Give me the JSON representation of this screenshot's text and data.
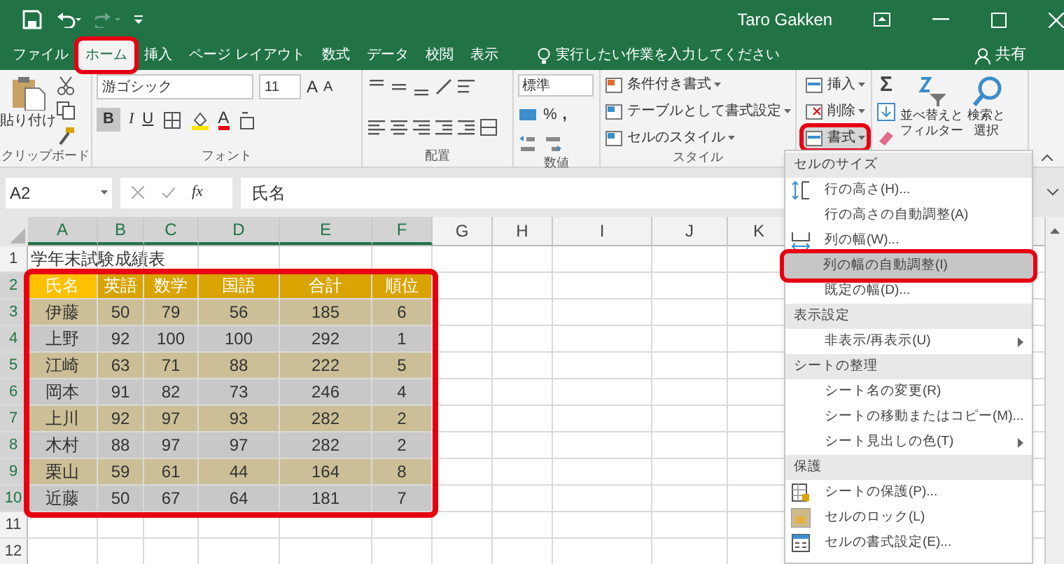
{
  "title_bar": {
    "user": "Taro Gakken"
  },
  "tabs": [
    {
      "label": "ファイル",
      "selected": false,
      "highlighted": false
    },
    {
      "label": "ホーム",
      "selected": true,
      "highlighted": true
    },
    {
      "label": "挿入",
      "selected": false,
      "highlighted": false
    },
    {
      "label": "ページ レイアウト",
      "selected": false,
      "highlighted": false
    },
    {
      "label": "数式",
      "selected": false,
      "highlighted": false
    },
    {
      "label": "データ",
      "selected": false,
      "highlighted": false
    },
    {
      "label": "校閲",
      "selected": false,
      "highlighted": false
    },
    {
      "label": "表示",
      "selected": false,
      "highlighted": false
    }
  ],
  "tell_me": {
    "placeholder": "実行したい作業を入力してください"
  },
  "share_button": "共有",
  "ribbon": {
    "clipboard": {
      "paste": "貼り付け",
      "label": "クリップボード"
    },
    "font": {
      "name": "游ゴシック",
      "size": "11",
      "grow": "A",
      "shrink": "A",
      "bold": "B",
      "italic": "I",
      "underline": "U",
      "font_color_letter": "A",
      "label": "フォント"
    },
    "alignment": {
      "label": "配置"
    },
    "number": {
      "format": "標準",
      "percent": "%",
      "comma": ",",
      "label": "数値"
    },
    "styles": {
      "items": [
        "条件付き書式",
        "テーブルとして書式設定",
        "セルのスタイル"
      ],
      "label": "スタイル"
    },
    "cells": {
      "items": [
        {
          "label": "挿入",
          "highlighted": false
        },
        {
          "label": "削除",
          "highlighted": false
        },
        {
          "label": "書式",
          "highlighted": true
        }
      ]
    },
    "editing": {
      "sum": "Σ",
      "sort": [
        "並べ替えと",
        "フィルター"
      ],
      "find": [
        "検索と",
        "選択"
      ]
    }
  },
  "formula_bar": {
    "name_box": "A2",
    "fx": "fx",
    "value": "氏名"
  },
  "sheet": {
    "table_highlighted": true,
    "columns": [
      {
        "label": "A",
        "selected": true
      },
      {
        "label": "B",
        "selected": true
      },
      {
        "label": "C",
        "selected": true
      },
      {
        "label": "D",
        "selected": true
      },
      {
        "label": "E",
        "selected": true
      },
      {
        "label": "F",
        "selected": true
      },
      {
        "label": "G",
        "selected": false
      },
      {
        "label": "H",
        "selected": false
      },
      {
        "label": "I",
        "selected": false
      },
      {
        "label": "J",
        "selected": false
      },
      {
        "label": "K",
        "selected": false
      }
    ],
    "rows": [
      {
        "label": "1",
        "selected": false,
        "kind": "title",
        "cells": [
          "学年末試験成績表"
        ]
      },
      {
        "label": "2",
        "selected": true,
        "kind": "header",
        "cells": [
          {
            "text": "氏名",
            "selected": true
          },
          {
            "text": "英語",
            "selected": false
          },
          {
            "text": "数学",
            "selected": false
          },
          {
            "text": "国語",
            "selected": false
          },
          {
            "text": "合計",
            "selected": false
          },
          {
            "text": "順位",
            "selected": false
          }
        ]
      },
      {
        "label": "3",
        "selected": true,
        "kind": "data",
        "cells": [
          "伊藤",
          "50",
          "79",
          "56",
          "185",
          "6"
        ]
      },
      {
        "label": "4",
        "selected": true,
        "kind": "data",
        "cells": [
          "上野",
          "92",
          "100",
          "100",
          "292",
          "1"
        ]
      },
      {
        "label": "5",
        "selected": true,
        "kind": "data",
        "cells": [
          "江崎",
          "63",
          "71",
          "88",
          "222",
          "5"
        ]
      },
      {
        "label": "6",
        "selected": true,
        "kind": "data",
        "cells": [
          "岡本",
          "91",
          "82",
          "73",
          "246",
          "4"
        ]
      },
      {
        "label": "7",
        "selected": true,
        "kind": "data",
        "cells": [
          "上川",
          "92",
          "97",
          "93",
          "282",
          "2"
        ]
      },
      {
        "label": "8",
        "selected": true,
        "kind": "data",
        "cells": [
          "木村",
          "88",
          "97",
          "97",
          "282",
          "2"
        ]
      },
      {
        "label": "9",
        "selected": true,
        "kind": "data",
        "cells": [
          "栗山",
          "59",
          "61",
          "44",
          "164",
          "8"
        ]
      },
      {
        "label": "10",
        "selected": true,
        "kind": "data",
        "cells": [
          "近藤",
          "50",
          "67",
          "64",
          "181",
          "7"
        ]
      },
      {
        "label": "11",
        "selected": false,
        "kind": "empty"
      },
      {
        "label": "12",
        "selected": false,
        "kind": "empty"
      }
    ]
  },
  "menu": {
    "sections": [
      {
        "heading": "セルのサイズ",
        "items": [
          {
            "label": "行の高さ(H)...",
            "kind": "height",
            "submenu": false,
            "highlighted": false
          },
          {
            "label": "行の高さの自動調整(A)",
            "kind": "plain",
            "submenu": false,
            "highlighted": false
          },
          {
            "label": "列の幅(W)...",
            "kind": "width",
            "submenu": false,
            "highlighted": false
          },
          {
            "label": "列の幅の自動調整(I)",
            "kind": "plain",
            "submenu": false,
            "highlighted": true
          },
          {
            "label": "既定の幅(D)...",
            "kind": "plain",
            "submenu": false,
            "highlighted": false
          }
        ]
      },
      {
        "heading": "表示設定",
        "items": [
          {
            "label": "非表示/再表示(U)",
            "kind": "plain",
            "submenu": true,
            "highlighted": false
          }
        ]
      },
      {
        "heading": "シートの整理",
        "items": [
          {
            "label": "シート名の変更(R)",
            "kind": "plain",
            "submenu": false,
            "highlighted": false
          },
          {
            "label": "シートの移動またはコピー(M)...",
            "kind": "plain",
            "submenu": false,
            "highlighted": false
          },
          {
            "label": "シート見出しの色(T)",
            "kind": "plain",
            "submenu": true,
            "highlighted": false
          }
        ]
      },
      {
        "heading": "保護",
        "items": [
          {
            "label": "シートの保護(P)...",
            "kind": "protect",
            "submenu": false,
            "highlighted": false
          },
          {
            "label": "セルのロック(L)",
            "kind": "lock",
            "submenu": false,
            "highlighted": false
          },
          {
            "label": "セルの書式設定(E)...",
            "kind": "format",
            "submenu": false,
            "highlighted": false
          }
        ]
      }
    ]
  }
}
